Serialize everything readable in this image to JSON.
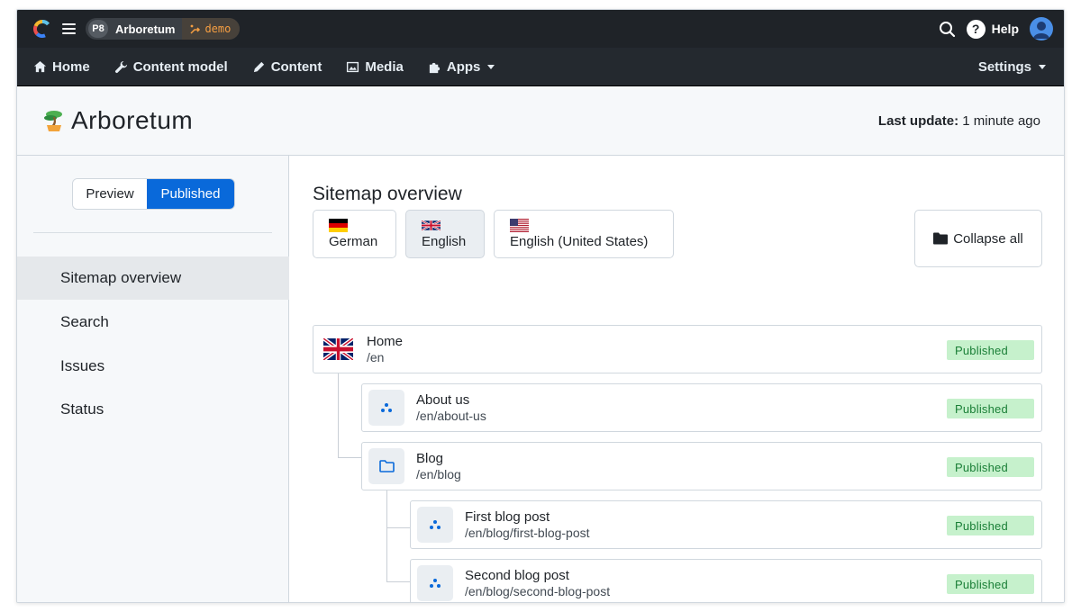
{
  "topbar": {
    "project_badge": "P8",
    "project_name": "Arboretum",
    "branch": "demo",
    "help_label": "Help"
  },
  "nav": {
    "items": [
      {
        "label": "Home",
        "icon": "home-icon"
      },
      {
        "label": "Content model",
        "icon": "wrench-icon"
      },
      {
        "label": "Content",
        "icon": "edit-icon"
      },
      {
        "label": "Media",
        "icon": "image-icon"
      },
      {
        "label": "Apps",
        "icon": "puzzle-icon"
      }
    ],
    "settings_label": "Settings"
  },
  "header": {
    "title": "Arboretum",
    "last_update_label": "Last update:",
    "last_update_value": "1 minute ago"
  },
  "sidebar": {
    "toggle": {
      "preview": "Preview",
      "published": "Published",
      "selected": "Published"
    },
    "items": [
      {
        "label": "Sitemap overview",
        "active": true
      },
      {
        "label": "Search",
        "active": false
      },
      {
        "label": "Issues",
        "active": false
      },
      {
        "label": "Status",
        "active": false
      }
    ]
  },
  "main": {
    "title": "Sitemap overview",
    "languages": [
      {
        "label": "German",
        "flag": "de",
        "selected": false
      },
      {
        "label": "English",
        "flag": "gb",
        "selected": true
      },
      {
        "label": "English (United States)",
        "flag": "us",
        "selected": false
      }
    ],
    "collapse_label": "Collapse all",
    "tree": [
      {
        "title": "Home",
        "path": "/en",
        "status": "Published",
        "icon": "uk-flag-icon",
        "depth": 0
      },
      {
        "title": "About us",
        "path": "/en/about-us",
        "status": "Published",
        "icon": "page-icon",
        "depth": 1
      },
      {
        "title": "Blog",
        "path": "/en/blog",
        "status": "Published",
        "icon": "folder-icon",
        "depth": 1
      },
      {
        "title": "First blog post",
        "path": "/en/blog/first-blog-post",
        "status": "Published",
        "icon": "page-icon",
        "depth": 2
      },
      {
        "title": "Second blog post",
        "path": "/en/blog/second-blog-post",
        "status": "Published",
        "icon": "page-icon",
        "depth": 2
      }
    ]
  },
  "colors": {
    "accent": "#0969da",
    "branch": "#f59e42",
    "badge_bg": "#c6f1cc",
    "badge_text": "#1a7f37"
  }
}
